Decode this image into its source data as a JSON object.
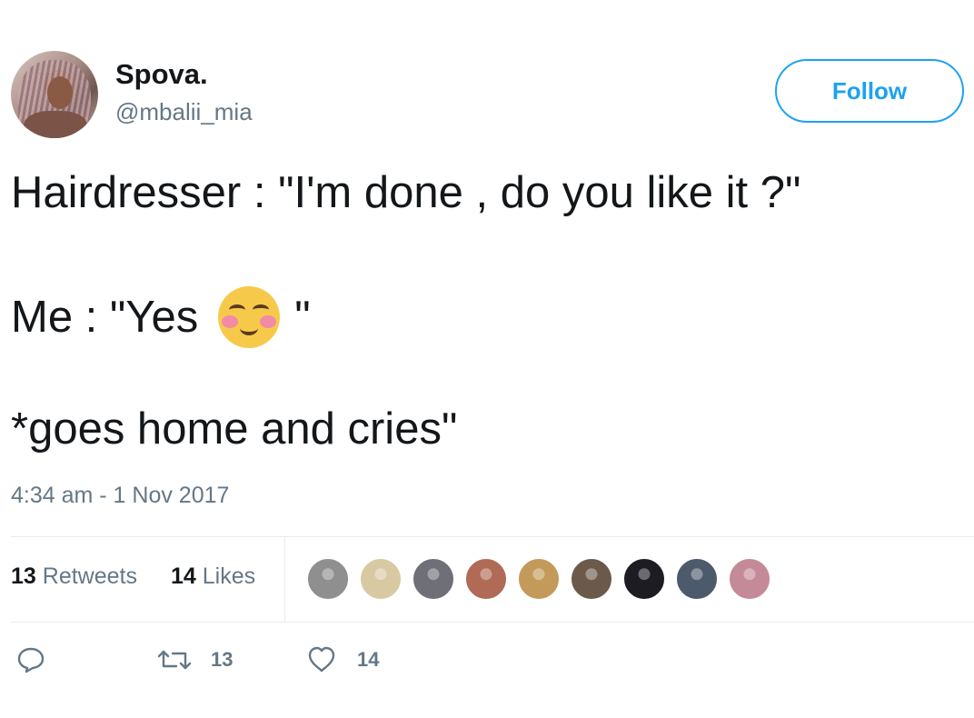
{
  "user": {
    "display_name": "Spova.",
    "handle": "@mbalii_mia",
    "follow_label": "Follow"
  },
  "tweet": {
    "line1": "Hairdresser : \"I'm done , do you like it ?\"",
    "line2_before": "Me : \"Yes",
    "line2_emoji": "smiling-face-with-blushing-cheeks",
    "line2_after": "\"",
    "line3": "*goes home and cries\"",
    "timestamp": "4:34 am - 1 Nov 2017"
  },
  "stats": {
    "retweets_count": "13",
    "retweets_label": "Retweets",
    "likes_count": "14",
    "likes_label": "Likes"
  },
  "likers": [
    {
      "color": "#8f8f8f"
    },
    {
      "color": "#d8c9a3"
    },
    {
      "color": "#6f6f78"
    },
    {
      "color": "#b06a55"
    },
    {
      "color": "#c49a5a"
    },
    {
      "color": "#6b5a4a"
    },
    {
      "color": "#1c1c22"
    },
    {
      "color": "#4d5a6b"
    },
    {
      "color": "#c48a98"
    }
  ],
  "actions": {
    "retweet_count": "13",
    "like_count": "14"
  },
  "colors": {
    "accent": "#1da1f2",
    "secondary_text": "#657786",
    "primary_text": "#14171a"
  }
}
